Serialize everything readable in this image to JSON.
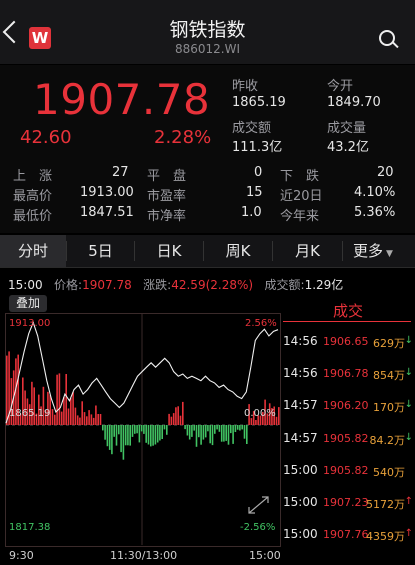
{
  "header": {
    "title": "钢铁指数",
    "code": "886012.WI",
    "logo_letter": "W"
  },
  "quote": {
    "price": "1907.78",
    "change": "42.60",
    "change_pct": "2.28%",
    "prev_close_label": "昨收",
    "prev_close": "1865.19",
    "open_label": "今开",
    "open": "1849.70",
    "turnover_label": "成交额",
    "turnover": "111.3亿",
    "volume_label": "成交量",
    "volume": "43.2亿",
    "up_label": "上　涨",
    "up": "27",
    "flat_label": "平　盘",
    "flat": "0",
    "down_label": "下　跌",
    "down": "20",
    "high_label": "最高价",
    "high": "1913.00",
    "pe_label": "市盈率",
    "pe": "15",
    "r20_label": "近20日",
    "r20": "4.10%",
    "low_label": "最低价",
    "low": "1847.51",
    "pb_label": "市净率",
    "pb": "1.0",
    "ytd_label": "今年来",
    "ytd": "5.36%"
  },
  "tabs": [
    {
      "label": "分时"
    },
    {
      "label": "5日"
    },
    {
      "label": "日K"
    },
    {
      "label": "周K"
    },
    {
      "label": "月K"
    },
    {
      "label": "更多"
    }
  ],
  "info": {
    "time": "15:00",
    "price_label": "价格:",
    "price": "1907.78",
    "chg_label": "涨跌:",
    "chg": "42.59(2.28%)",
    "amount_label": "成交额:",
    "amount": "1.29亿"
  },
  "chart": {
    "overlay_label": "叠加",
    "y_top": "1913.00",
    "y_mid": "1865.19",
    "y_bot": "1817.38",
    "p_top": "2.56%",
    "p_mid": "0.00%",
    "p_bot": "-2.56%",
    "t_start": "9:30",
    "t_mid": "11:30/13:00",
    "t_end": "15:00"
  },
  "chart_data": {
    "type": "line",
    "ylim": [
      1817.38,
      1913.0
    ],
    "base": 1865.19,
    "x_ticks": [
      "9:30",
      "11:30/13:00",
      "15:00"
    ],
    "series": [
      {
        "values": [
          1866,
          1872,
          1880,
          1889,
          1898,
          1906,
          1911,
          1905,
          1895,
          1885,
          1877,
          1871,
          1873,
          1879,
          1876,
          1881,
          1883,
          1879,
          1881,
          1884,
          1886,
          1883,
          1880,
          1877,
          1875,
          1873,
          1875,
          1879,
          1883,
          1887,
          1889,
          1891,
          1893,
          1891,
          1893,
          1895,
          1893,
          1889,
          1887,
          1888,
          1886,
          1887,
          1886,
          1885,
          1887,
          1885,
          1884,
          1882,
          1883,
          1881,
          1880,
          1878,
          1877,
          1880,
          1891,
          1903,
          1906,
          1908,
          1905,
          1907,
          1907.78
        ]
      }
    ]
  },
  "trades": {
    "title": "成交",
    "rows": [
      {
        "time": "14:56",
        "price": "1906.65",
        "vol": "629万",
        "dir": "down"
      },
      {
        "time": "14:56",
        "price": "1906.78",
        "vol": "854万",
        "dir": "down"
      },
      {
        "time": "14:57",
        "price": "1906.20",
        "vol": "170万",
        "dir": "down"
      },
      {
        "time": "14:57",
        "price": "1905.82",
        "vol": "84.2万",
        "dir": "down"
      },
      {
        "time": "15:00",
        "price": "1905.82",
        "vol": "540万",
        "dir": ""
      },
      {
        "time": "15:00",
        "price": "1907.23",
        "vol": "5172万",
        "dir": "up"
      },
      {
        "time": "15:00",
        "price": "1907.76",
        "vol": "4359万",
        "dir": "up"
      }
    ]
  },
  "colors": {
    "up": "#e8323a",
    "down": "#41c363",
    "accent": "#e8a13a"
  }
}
